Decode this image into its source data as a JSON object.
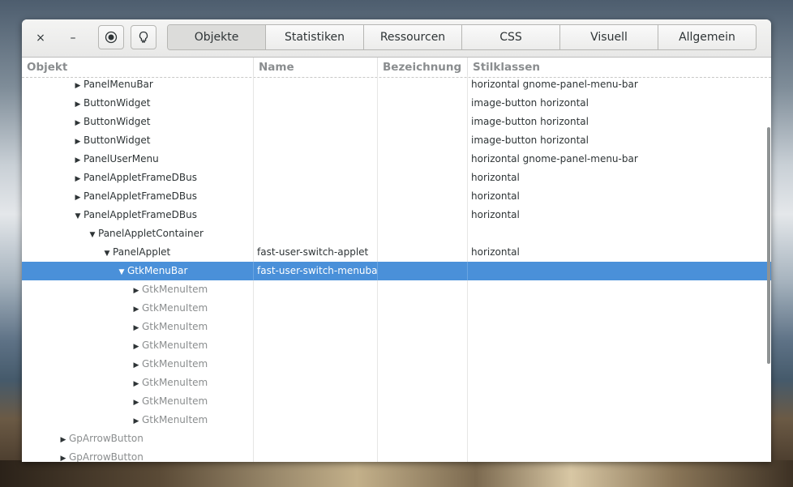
{
  "toolbar": {
    "close_symbol": "×",
    "minimize_symbol": "–",
    "tabs": [
      "Objekte",
      "Statistiken",
      "Ressourcen",
      "CSS",
      "Visuell",
      "Allgemein"
    ],
    "active_tab": "Objekte"
  },
  "columns": [
    "Objekt",
    "Name",
    "Bezeichnung",
    "Stilklassen"
  ],
  "rows": [
    {
      "object": "PanelMenuBar",
      "indent": 3,
      "arrow": "right",
      "name": "",
      "label": "",
      "classes": "horizontal gnome-panel-menu-bar"
    },
    {
      "object": "ButtonWidget",
      "indent": 3,
      "arrow": "right",
      "name": "",
      "label": "",
      "classes": "image-button horizontal"
    },
    {
      "object": "ButtonWidget",
      "indent": 3,
      "arrow": "right",
      "name": "",
      "label": "",
      "classes": "image-button horizontal"
    },
    {
      "object": "ButtonWidget",
      "indent": 3,
      "arrow": "right",
      "name": "",
      "label": "",
      "classes": "image-button horizontal"
    },
    {
      "object": "PanelUserMenu",
      "indent": 3,
      "arrow": "right",
      "name": "",
      "label": "",
      "classes": "horizontal gnome-panel-menu-bar"
    },
    {
      "object": "PanelAppletFrameDBus",
      "indent": 3,
      "arrow": "right",
      "name": "",
      "label": "",
      "classes": "horizontal"
    },
    {
      "object": "PanelAppletFrameDBus",
      "indent": 3,
      "arrow": "right",
      "name": "",
      "label": "",
      "classes": "horizontal"
    },
    {
      "object": "PanelAppletFrameDBus",
      "indent": 3,
      "arrow": "down",
      "name": "",
      "label": "",
      "classes": "horizontal"
    },
    {
      "object": "PanelAppletContainer",
      "indent": 4,
      "arrow": "down",
      "name": "",
      "label": "",
      "classes": ""
    },
    {
      "object": "PanelApplet",
      "indent": 5,
      "arrow": "down",
      "name": "fast-user-switch-applet",
      "label": "",
      "classes": "horizontal"
    },
    {
      "object": "GtkMenuBar",
      "indent": 6,
      "arrow": "down",
      "name": "fast-user-switch-menubar",
      "label": "",
      "classes": "",
      "selected": true
    },
    {
      "object": "GtkMenuItem",
      "indent": 7,
      "arrow": "right",
      "name": "",
      "label": "",
      "classes": "",
      "dim": true
    },
    {
      "object": "GtkMenuItem",
      "indent": 7,
      "arrow": "right",
      "name": "",
      "label": "",
      "classes": "",
      "dim": true
    },
    {
      "object": "GtkMenuItem",
      "indent": 7,
      "arrow": "right",
      "name": "",
      "label": "",
      "classes": "",
      "dim": true
    },
    {
      "object": "GtkMenuItem",
      "indent": 7,
      "arrow": "right",
      "name": "",
      "label": "",
      "classes": "",
      "dim": true
    },
    {
      "object": "GtkMenuItem",
      "indent": 7,
      "arrow": "right",
      "name": "",
      "label": "",
      "classes": "",
      "dim": true
    },
    {
      "object": "GtkMenuItem",
      "indent": 7,
      "arrow": "right",
      "name": "",
      "label": "",
      "classes": "",
      "dim": true
    },
    {
      "object": "GtkMenuItem",
      "indent": 7,
      "arrow": "right",
      "name": "",
      "label": "",
      "classes": "",
      "dim": true
    },
    {
      "object": "GtkMenuItem",
      "indent": 7,
      "arrow": "right",
      "name": "",
      "label": "",
      "classes": "",
      "dim": true
    },
    {
      "object": "GpArrowButton",
      "indent": 2,
      "arrow": "right",
      "name": "",
      "label": "",
      "classes": "",
      "dim": true
    },
    {
      "object": "GpArrowButton",
      "indent": 2,
      "arrow": "right",
      "name": "",
      "label": "",
      "classes": "",
      "dim": true
    }
  ]
}
